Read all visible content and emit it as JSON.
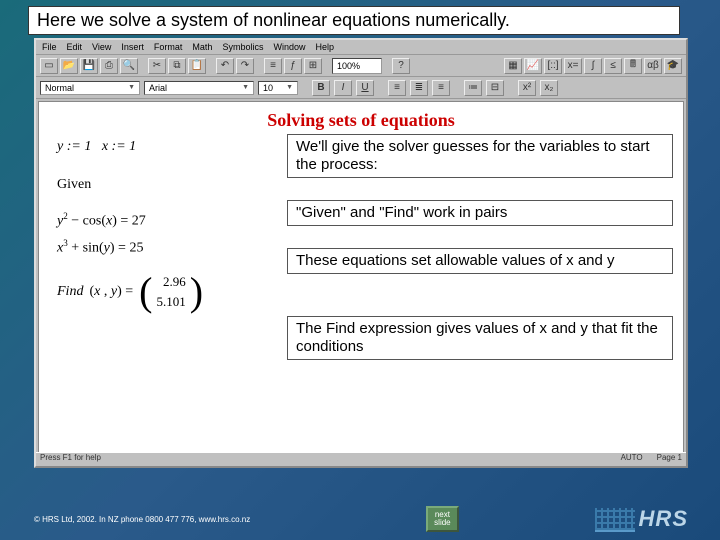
{
  "header": {
    "title": "Here we solve a system of nonlinear equations numerically."
  },
  "menubar": [
    "File",
    "Edit",
    "View",
    "Insert",
    "Format",
    "Math",
    "Symbolics",
    "Window",
    "Help"
  ],
  "zoom": "100%",
  "format": {
    "style": "Normal",
    "font": "Arial",
    "size": "10",
    "bold": "B",
    "italic": "I",
    "underline": "U"
  },
  "doc": {
    "title": "Solving sets of equations",
    "assign1": "y := 1   x := 1",
    "given": "Given",
    "eq1_lhs": "y² − cos(x)",
    "eq1_rhs": "27",
    "eq2_lhs": "x³ + sin(y)",
    "eq2_rhs": "25",
    "find_expr": "Find(x , y) =",
    "find_vals": [
      "2.96",
      "5.101"
    ]
  },
  "callouts": {
    "c1": "We'll give the solver guesses for the variables to start the process:",
    "c2": "\"Given\" and \"Find\" work in pairs",
    "c3": "These equations set allowable values of x and y",
    "c4": "The Find expression gives values of x and y that fit the conditions"
  },
  "statusbar": {
    "left": "Press F1 for help",
    "auto": "AUTO",
    "page": "Page 1"
  },
  "footer": {
    "copyright": "© HRS Ltd, 2002.  In NZ phone 0800 477 776, www.hrs.co.nz",
    "next_l1": "next",
    "next_l2": "slide",
    "logo": "HRS"
  }
}
